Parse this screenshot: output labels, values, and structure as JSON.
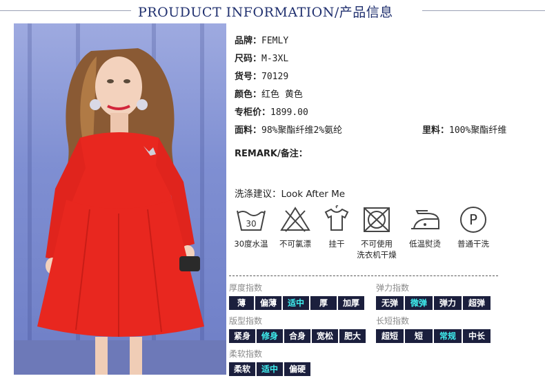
{
  "header": {
    "title": "PROUDUCT INFORMATION/产品信息"
  },
  "info": {
    "brand": {
      "label": "品牌：",
      "value": "FEMLY"
    },
    "size": {
      "label": "尺码：",
      "value": "M-3XL"
    },
    "item_no": {
      "label": "货号：",
      "value": "70129"
    },
    "color": {
      "label": "颜色：",
      "value": "红色 黄色"
    },
    "price": {
      "label": "专柜价：",
      "value": "1899.00"
    },
    "fabric": {
      "label": "面料：",
      "value": "98%聚酯纤维2%氨纶"
    },
    "lining": {
      "label": "里料：",
      "value": "100%聚酯纤维"
    },
    "remark": {
      "label": "REMARK/备注："
    }
  },
  "care": {
    "title": "洗涤建议：Look After Me",
    "items": [
      {
        "icon": "wash-30-icon",
        "label": "30度水温",
        "text": "30"
      },
      {
        "icon": "no-bleach-icon",
        "label": "不可氯漂"
      },
      {
        "icon": "hang-dry-icon",
        "label": "挂干"
      },
      {
        "icon": "no-tumble-dry-icon",
        "label": "不可使用",
        "label2": "洗衣机干燥"
      },
      {
        "icon": "low-iron-icon",
        "label": "低温熨烫"
      },
      {
        "icon": "dry-clean-p-icon",
        "label": "普通干洗",
        "text": "P"
      }
    ]
  },
  "attributes": {
    "thickness": {
      "label": "厚度指数",
      "options": [
        "薄",
        "偏薄",
        "适中",
        "厚",
        "加厚"
      ],
      "selected": 2
    },
    "elasticity": {
      "label": "弹力指数",
      "options": [
        "无弹",
        "微弹",
        "弹力",
        "超弹"
      ],
      "selected": 1
    },
    "fit": {
      "label": "版型指数",
      "options": [
        "紧身",
        "修身",
        "合身",
        "宽松",
        "肥大"
      ],
      "selected": 1
    },
    "length": {
      "label": "长短指数",
      "options": [
        "超短",
        "短",
        "常规",
        "中长"
      ],
      "selected": 2
    },
    "softness": {
      "label": "柔软指数",
      "options": [
        "柔软",
        "适中",
        "偏硬"
      ],
      "selected": 1
    }
  },
  "colors": {
    "dress": "#e8271f",
    "backdrop": "#7f8fd2",
    "chip_bg": "#1b1f3d",
    "chip_selected": "#3ff0f0"
  }
}
